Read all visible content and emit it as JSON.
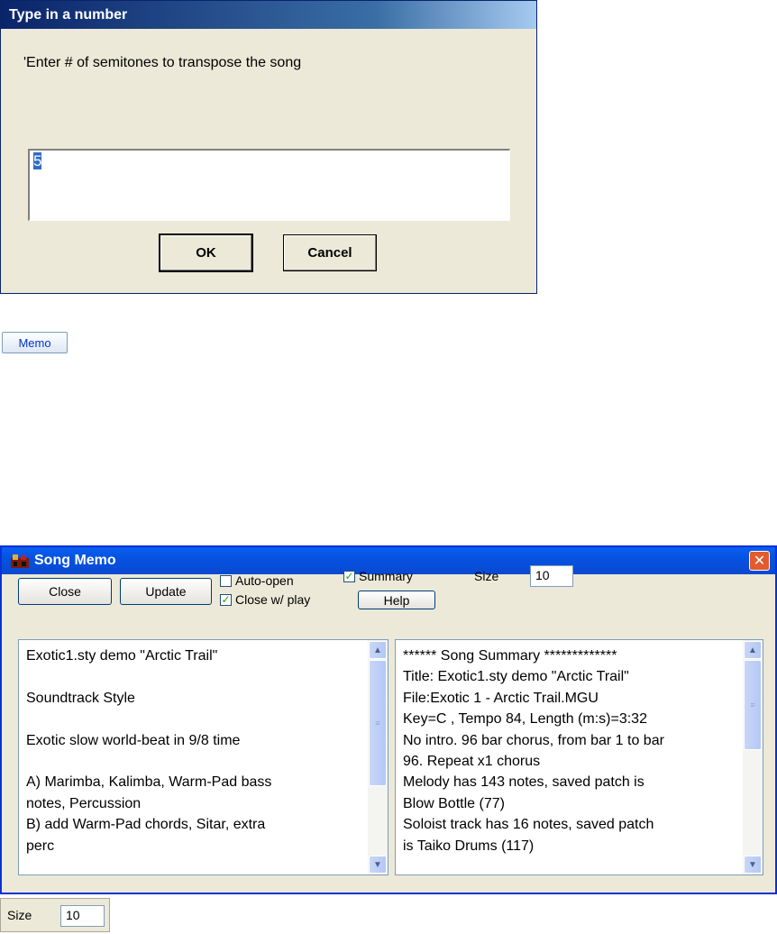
{
  "number_dialog": {
    "title": "Type in a number",
    "prompt": "'Enter # of semitones to transpose the song",
    "value": "5",
    "ok_label": "OK",
    "cancel_label": "Cancel"
  },
  "memo_button": {
    "label": "Memo"
  },
  "song_memo": {
    "title": "Song Memo",
    "close_label": "Close",
    "update_label": "Update",
    "help_label": "Help",
    "auto_open": {
      "label": "Auto-open",
      "checked": false
    },
    "close_with_play": {
      "label": "Close w/ play",
      "checked": true
    },
    "summary": {
      "label": "Summary",
      "checked": true
    },
    "size_label": "Size",
    "size_value": "10",
    "memo_lines": [
      "Exotic1.sty demo \"Arctic Trail\"",
      "",
      "Soundtrack Style",
      "",
      "Exotic slow world-beat in 9/8 time",
      "",
      "A) Marimba, Kalimba, Warm-Pad bass",
      "notes, Percussion",
      "B) add Warm-Pad chords, Sitar, extra",
      "perc"
    ],
    "summary_lines": [
      "******   Song Summary    *************",
      "Title: Exotic1.sty demo \"Arctic Trail\"",
      "File:Exotic 1 - Arctic Trail.MGU",
      "Key=C   , Tempo 84, Length (m:s)=3:32",
      "No intro. 96 bar chorus, from bar 1 to bar",
      "96.  Repeat x1 chorus",
      "Melody has 143 notes, saved patch is",
      "Blow Bottle (77)",
      "Soloist track has 16 notes, saved patch",
      "is Taiko Drums (117)"
    ]
  },
  "size_control": {
    "label": "Size",
    "value": "10"
  },
  "colors": {
    "dialog_bg": "#ece9d8",
    "classic_title": "#0a246a",
    "xp_title": "#0553e1",
    "selection": "#316ac5",
    "check_green": "#21a121"
  }
}
